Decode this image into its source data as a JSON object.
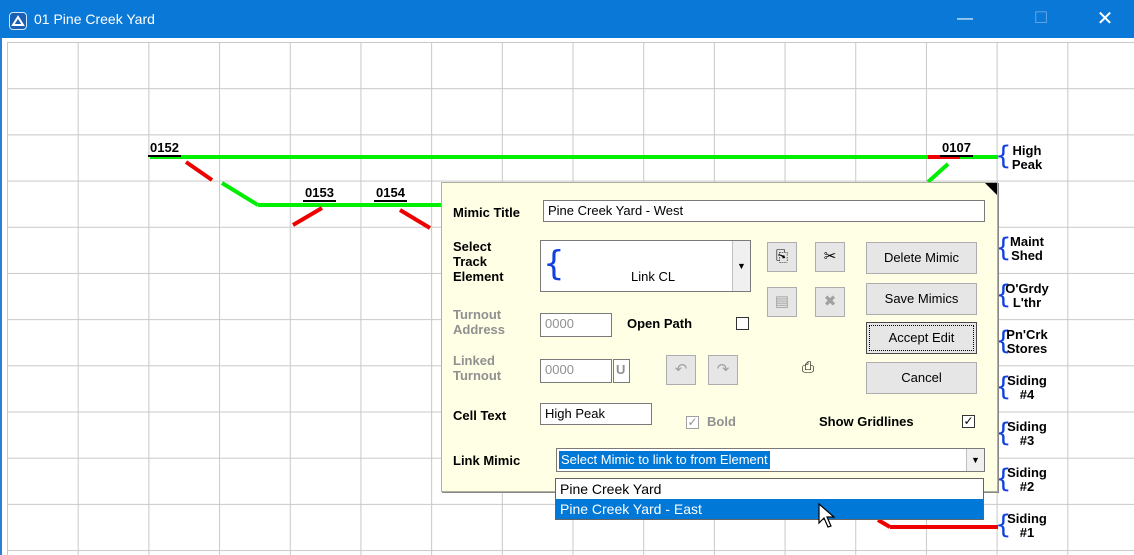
{
  "window": {
    "title": "01 Pine Creek Yard",
    "minimize_glyph": "—",
    "maximize_glyph": "☐",
    "close_glyph": "✕"
  },
  "track": {
    "numbers": [
      "0152",
      "0153",
      "0154",
      "0107"
    ],
    "colors": {
      "clear": "#00ee00",
      "set": "#ee0000",
      "brace": "#1040e0"
    },
    "right_labels": [
      {
        "line1": "High",
        "line2": "Peak"
      },
      {
        "line1": "Maint",
        "line2": "Shed"
      },
      {
        "line1": "O'Grdy",
        "line2": "L'thr"
      },
      {
        "line1": "Pn'Crk",
        "line2": "Stores"
      },
      {
        "line1": "Siding",
        "line2": "#4"
      },
      {
        "line1": "Siding",
        "line2": "#3"
      },
      {
        "line1": "Siding",
        "line2": "#2"
      },
      {
        "line1": "Siding",
        "line2": "#1"
      }
    ]
  },
  "dialog": {
    "mimic_title_label": "Mimic Title",
    "mimic_title_value": "Pine Creek Yard - West",
    "select_label_1": "Select",
    "select_label_2": "Track",
    "select_label_3": "Element",
    "select_value": "Link CL",
    "turnout_address_label_1": "Turnout",
    "turnout_address_label_2": "Address",
    "turnout_address_value": "0000",
    "open_path_label": "Open Path",
    "linked_turnout_label_1": "Linked",
    "linked_turnout_label_2": "Turnout",
    "linked_turnout_value": "0000",
    "linked_turnout_suffix": "U",
    "cell_text_label": "Cell Text",
    "cell_text_value": "High Peak",
    "bold_label": "Bold",
    "show_gridlines_label": "Show Gridlines",
    "link_mimic_label": "Link Mimic",
    "link_mimic_value": "Select Mimic to link to from Element",
    "buttons": {
      "delete": "Delete Mimic",
      "save": "Save Mimics",
      "accept": "Accept Edit",
      "cancel": "Cancel"
    },
    "icons": {
      "copy": "copy-icon",
      "cut": "scissors-icon",
      "paste": "paste-icon",
      "delete_element": "delete-element-icon",
      "undo": "undo-icon",
      "redo": "redo-icon",
      "print": "printer-icon"
    },
    "dropdown_options": [
      "Pine Creek Yard",
      "Pine Creek Yard - East"
    ],
    "dropdown_selected": "Pine Creek Yard - East"
  }
}
